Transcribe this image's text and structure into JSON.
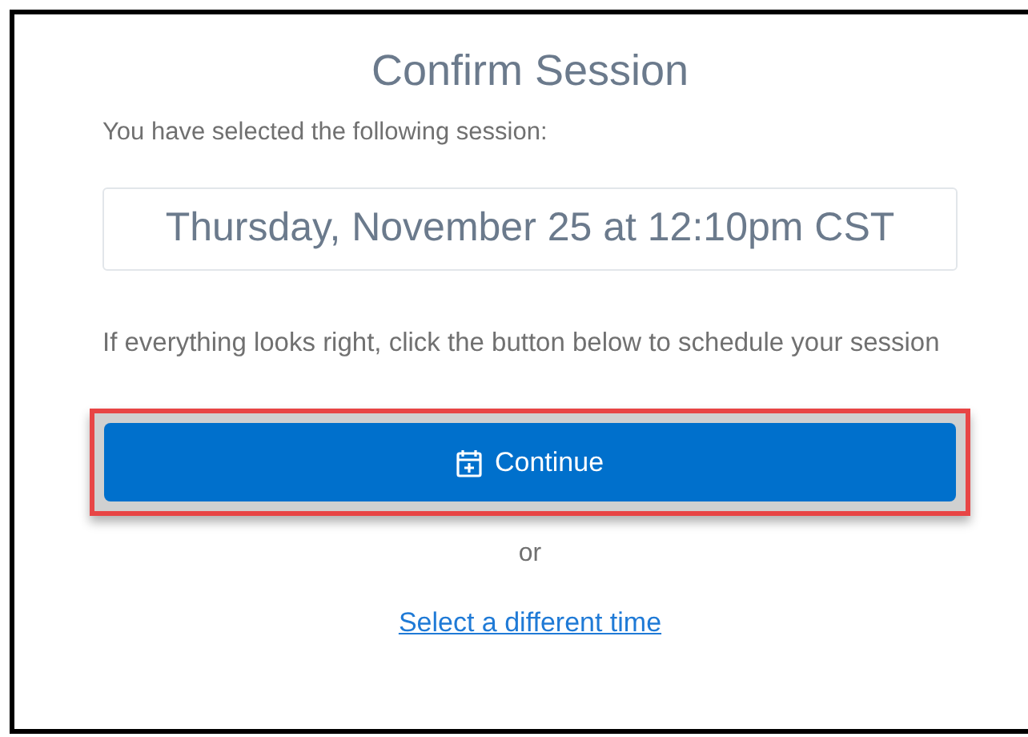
{
  "title": "Confirm Session",
  "intro": "You have selected the following session:",
  "session": "Thursday, November 25 at 12:10pm CST",
  "instructions": "If everything looks right, click the button below to schedule your session",
  "continue_button": {
    "label": "Continue",
    "highlighted": true
  },
  "separator": "or",
  "link": "Select a different time"
}
